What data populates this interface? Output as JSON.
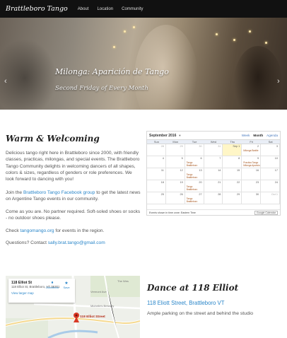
{
  "nav": {
    "brand": "Brattleboro Tango",
    "links": [
      "About",
      "Location",
      "Community"
    ]
  },
  "hero": {
    "title": "Milonga: Aparición de Tango",
    "subtitle": "Second Friday of Every Month",
    "slides": 3
  },
  "welcome": {
    "title": "Warm & Welcoming",
    "p1": "Delicious tango right here in Brattleboro since 2000, with friendly classes, practicas, milongas, and special events. The Brattleboro Tango Community delights in welcoming dancers of all shapes, colors & sizes, regardless of genders or role preferences. We look forward to dancing with you!",
    "p2_before": "Join the ",
    "p2_link": "Brattleboro Tango Facebook group",
    "p2_after": " to get the latest news on Argentine Tango events in our community.",
    "p3": "Come as you are. No partner required. Soft-soled shoes or socks - no outdoor shoes please.",
    "p4_before": "Check ",
    "p4_link": "tangomango.org",
    "p4_after": " for events in the region.",
    "p5_before": "Questions? Contact ",
    "p5_link": "sally.brat.tango@gmail.com"
  },
  "calendar": {
    "month": "September 2016",
    "views": [
      "Week",
      "Month",
      "Agenda"
    ],
    "active_view": "Month",
    "weekdays": [
      "Sun",
      "Mon",
      "Tue",
      "Wed",
      "Thu",
      "Fri",
      "Sat"
    ],
    "weeks": [
      [
        {
          "d": "28",
          "o": true
        },
        {
          "d": "29",
          "o": true
        },
        {
          "d": "30",
          "o": true
        },
        {
          "d": "31",
          "o": true
        },
        {
          "d": "Sep 1",
          "today": true
        },
        {
          "d": "2",
          "e": "Milonga Brattle"
        },
        {
          "d": "3"
        }
      ],
      [
        {
          "d": "4"
        },
        {
          "d": "5"
        },
        {
          "d": "6",
          "e": "Tango Brattleboro"
        },
        {
          "d": "7"
        },
        {
          "d": "8"
        },
        {
          "d": "9",
          "e": "Practica Tango Milonga Aparicio"
        },
        {
          "d": "10"
        }
      ],
      [
        {
          "d": "11"
        },
        {
          "d": "12"
        },
        {
          "d": "13",
          "e": "Tango Brattleboro"
        },
        {
          "d": "14"
        },
        {
          "d": "15"
        },
        {
          "d": "16"
        },
        {
          "d": "17"
        }
      ],
      [
        {
          "d": "18"
        },
        {
          "d": "19"
        },
        {
          "d": "20",
          "e": "Tango Brattleboro"
        },
        {
          "d": "21"
        },
        {
          "d": "22"
        },
        {
          "d": "23"
        },
        {
          "d": "24"
        }
      ],
      [
        {
          "d": "25"
        },
        {
          "d": "26"
        },
        {
          "d": "27",
          "e": "Tango Brattleboro"
        },
        {
          "d": "28"
        },
        {
          "d": "29"
        },
        {
          "d": "30"
        },
        {
          "d": "Oct 1",
          "o": true
        }
      ]
    ],
    "footer": "Events shown in time zone: Eastern Time",
    "badge": "Google Calendar"
  },
  "map": {
    "place_name": "118 Elliot St",
    "place_addr": "118 Elliot St, Brattleboro, VT 05301",
    "larger_map": "View larger map",
    "directions": "Directions",
    "save": "Save",
    "pin_label": "118 Elliot Street",
    "streets": [
      "Michelle's Brewery",
      "Vermont Ave",
      "The Wes"
    ]
  },
  "dance": {
    "title": "Dance at 118 Elliot",
    "address": "118 Eliott Street, Brattleboro VT",
    "note": "Ample parking on the street and behind the studio"
  }
}
